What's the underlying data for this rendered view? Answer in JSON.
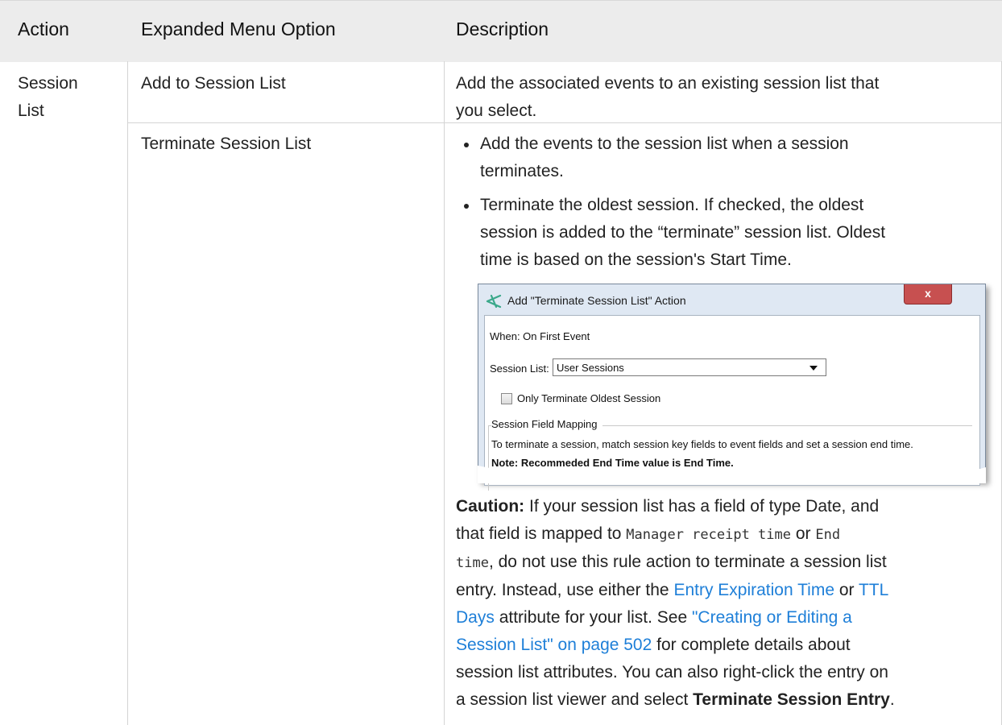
{
  "headers": [
    "Action",
    "Expanded Menu Option",
    "Description"
  ],
  "row1": {
    "action_line1": "Session",
    "action_line2": "List",
    "option": "Add to Session List",
    "desc_line1": "Add the associated events to an existing session list that",
    "desc_line2": "you select."
  },
  "row2": {
    "option": "Terminate Session List",
    "bullets": [
      [
        "Add the events to the session list when a session",
        "terminates."
      ],
      [
        "Terminate the oldest session. If checked, the oldest",
        "session is added to the “terminate” session list. Oldest",
        "time is based on the session's Start Time."
      ]
    ]
  },
  "dialog": {
    "title": "Add \"Terminate Session List\" Action",
    "close": "x",
    "when": "When: On First Event",
    "session_list_label": "Session List:",
    "session_list_value": "User Sessions",
    "checkbox_label": "Only Terminate Oldest Session",
    "group_label": "Session Field Mapping",
    "group_text": "To terminate a session, match session key fields to event fields and set a session end time.",
    "note": "Note: Recommeded End Time value is End Time."
  },
  "caution": {
    "label": "Caution:",
    "t1": " If your session list has a field of type Date, and",
    "t2": "that field is mapped to ",
    "code1": "Manager receipt time",
    "t3": " or ",
    "code2a": "End",
    "code2b": "time",
    "t4": ", do not use this rule action to terminate a session list",
    "t5": "entry. Instead, use either the ",
    "link1": "Entry Expiration Time",
    "t6": " or ",
    "link2a": "TTL",
    "link2b": "Days",
    "t7": " attribute for your list. See ",
    "link3a": "\"Creating or Editing a",
    "link3b": "Session List\" on page 502",
    "t8": " for complete details about",
    "t9": "session list attributes. You can also right-click the entry on",
    "t10": "a session list viewer and select ",
    "bold_end": "Terminate Session Entry",
    "t11": "."
  },
  "colors": {
    "header_bg": "#ececec",
    "grid": "#d4d4d4",
    "link": "#1e7fd8"
  }
}
